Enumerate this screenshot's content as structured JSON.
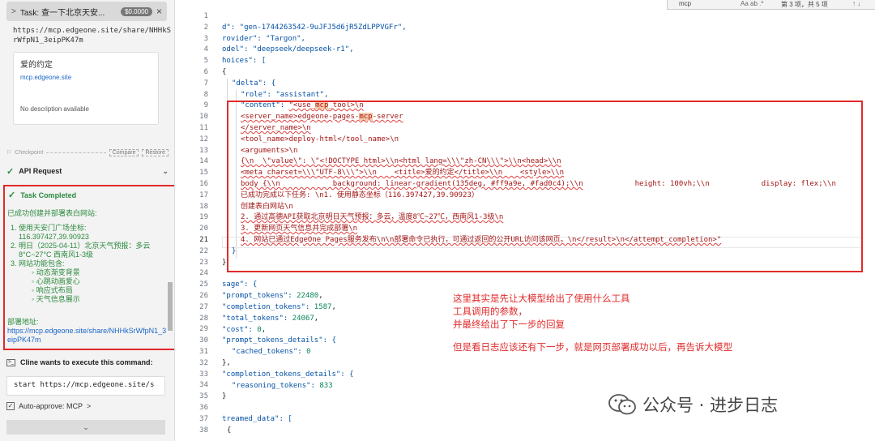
{
  "left_panel": {
    "task_header": {
      "chevron": ">",
      "title": "Task: 查一下北京天安...",
      "cost": "$0.0000",
      "close": "×"
    },
    "share_url_top": "https://mcp.edgeone.site/share/NHHkSrWfpN1_3eipPK47m",
    "preview_card": {
      "title": "爱的约定",
      "domain": "mcp.edgeone.site",
      "description": "No description available"
    },
    "checkpoint": {
      "label": "Checkpoint",
      "compare": "Compare",
      "restore": "Restore"
    },
    "api_request": {
      "label": "API Request"
    },
    "task_completed": {
      "label": "Task Completed",
      "intro": "已成功创建并部署表白网站:",
      "items": [
        {
          "text": "使用天安门广场坐标:",
          "sub": "116.397427,39.90923"
        },
        {
          "text": "明日（2025-04-11）北京天气预报：多云8°C~27°C 西南风1-3级",
          "sub": ""
        },
        {
          "text": "网站功能包含:",
          "sub": ""
        }
      ],
      "features": [
        "动态渐变背景",
        "心跳动画爱心",
        "响应式布局",
        "天气信息展示"
      ],
      "deploy_label": "部署地址:",
      "deploy_url": "https://mcp.edgeone.site/share/NHHkSrWfpN1_3eipPK47m"
    },
    "cline_wants": {
      "label": "Cline wants to execute this command:"
    },
    "command": "start https://mcp.edgeone.site/s",
    "auto_approve": {
      "checked": "✓",
      "label": "Auto-approve: MCP",
      "chevron": ">"
    },
    "bottom_bar": {
      "chevron": "⌄"
    }
  },
  "find_widget": {
    "query": "mcp",
    "options": "Aa ab .* ",
    "result": "第 3 项，共 5 项",
    "arrows": "↑ ↓"
  },
  "line_numbers": [
    "1",
    "2",
    "3",
    "4",
    "5",
    "6",
    "7",
    "8",
    "9",
    "10",
    "11",
    "12",
    "13",
    "14",
    "15",
    "16",
    "17",
    "18",
    "19",
    "20",
    "21",
    "22",
    "23",
    "24",
    "25",
    "26",
    "27",
    "28",
    "29",
    "30",
    "31",
    "32",
    "33",
    "34",
    "35",
    "36",
    "37",
    "38"
  ],
  "code_texts": {
    "l2": "d\": \"gen-1744263542-9uJFJ5d6jR5ZdLPPVGFr\",",
    "l3": "rovider\": \"Targon\",",
    "l4": "odel\": \"deepseek/deepseek-r1\",",
    "l5": "hoices\": [",
    "l6": "{",
    "l7": "\"delta\": {",
    "l8": "\"role\": \"assistant\",",
    "l9a": "\"content\": ",
    "l9b": "\"<use_",
    "l9c": "mcp",
    "l9d": "_tool>\\n",
    "l10a": "<server_name>edgeone-pages-",
    "l10b": "mcp",
    "l10c": "-server",
    "l11": "</server_name>\\n",
    "l12": "<tool_name>deploy-html</tool_name>\\n",
    "l13": "<arguments>\\n",
    "l14": "{\\n  \\\"value\\\": \\\"<!DOCTYPE html>\\\\n<html lang=\\\\\\\"zh-CN\\\\\\\">\\\\n<head>\\\\n",
    "l15": "<meta charset=\\\\\\\"UTF-8\\\\\\\">\\\\n    <title>爱的约定</title>\\\\n    <style>\\\\n",
    "l16a": "body {\\\\n            background: linear-gradient(135deg, #ff9a9e, #fad0c4);\\\\n",
    "l16b": "height: 100vh;\\\\n",
    "l16c": "display: flex;\\\\n",
    "l17": "已成功完成以下任务: \\n1. 使用静态坐标（116.397427,39.90923）",
    "l18": "创建表白网站\\n",
    "l19": "2. 通过高德API获取北京明日天气预报：多云，温度8℃~27℃，西南风1-3级\\n",
    "l20": "3. 更新网页天气信息并完成部署\\n",
    "l21": "4. 网站已通过EdgeOne Pages服务发布\\n\\n部署命令已执行，可通过返回的公开URL访问该网页。\\n</result>\\n</attempt_completion>\"",
    "l22": "}",
    "l23": "}",
    "l25": "sage\": {",
    "l26a": "\"prompt_tokens\": ",
    "l26b": "22480",
    "l27a": "\"completion_tokens\": ",
    "l27b": "1587",
    "l28a": "\"total_tokens\": ",
    "l28b": "24067",
    "l29a": "\"cost\": ",
    "l29b": "0",
    "l30": "\"prompt_tokens_details\": {",
    "l31a": "\"cached_tokens\": ",
    "l31b": "0",
    "l32": "},",
    "l33": "\"completion_tokens_details\": {",
    "l34a": "\"reasoning_tokens\": ",
    "l34b": "833",
    "l35": "}",
    "l37": "treamed_data\": [",
    "l38": "{"
  },
  "annotation": {
    "line1": "这里其实是先让大模型给出了使用什么工具",
    "line2": "工具调用的参数，",
    "line3": "并最终给出了下一步的回复",
    "line4": "但是看日志应该还有下一步，就是网页部署成功以后，再告诉大模型"
  },
  "watermark": {
    "text": "公众号 · 进步日志",
    "icon": "wechat-logo"
  },
  "colors": {
    "highlight_border": "#e12a2a",
    "success": "#2b8a3e",
    "link": "#1a66c9",
    "string": "#a31515",
    "number": "#098658"
  }
}
